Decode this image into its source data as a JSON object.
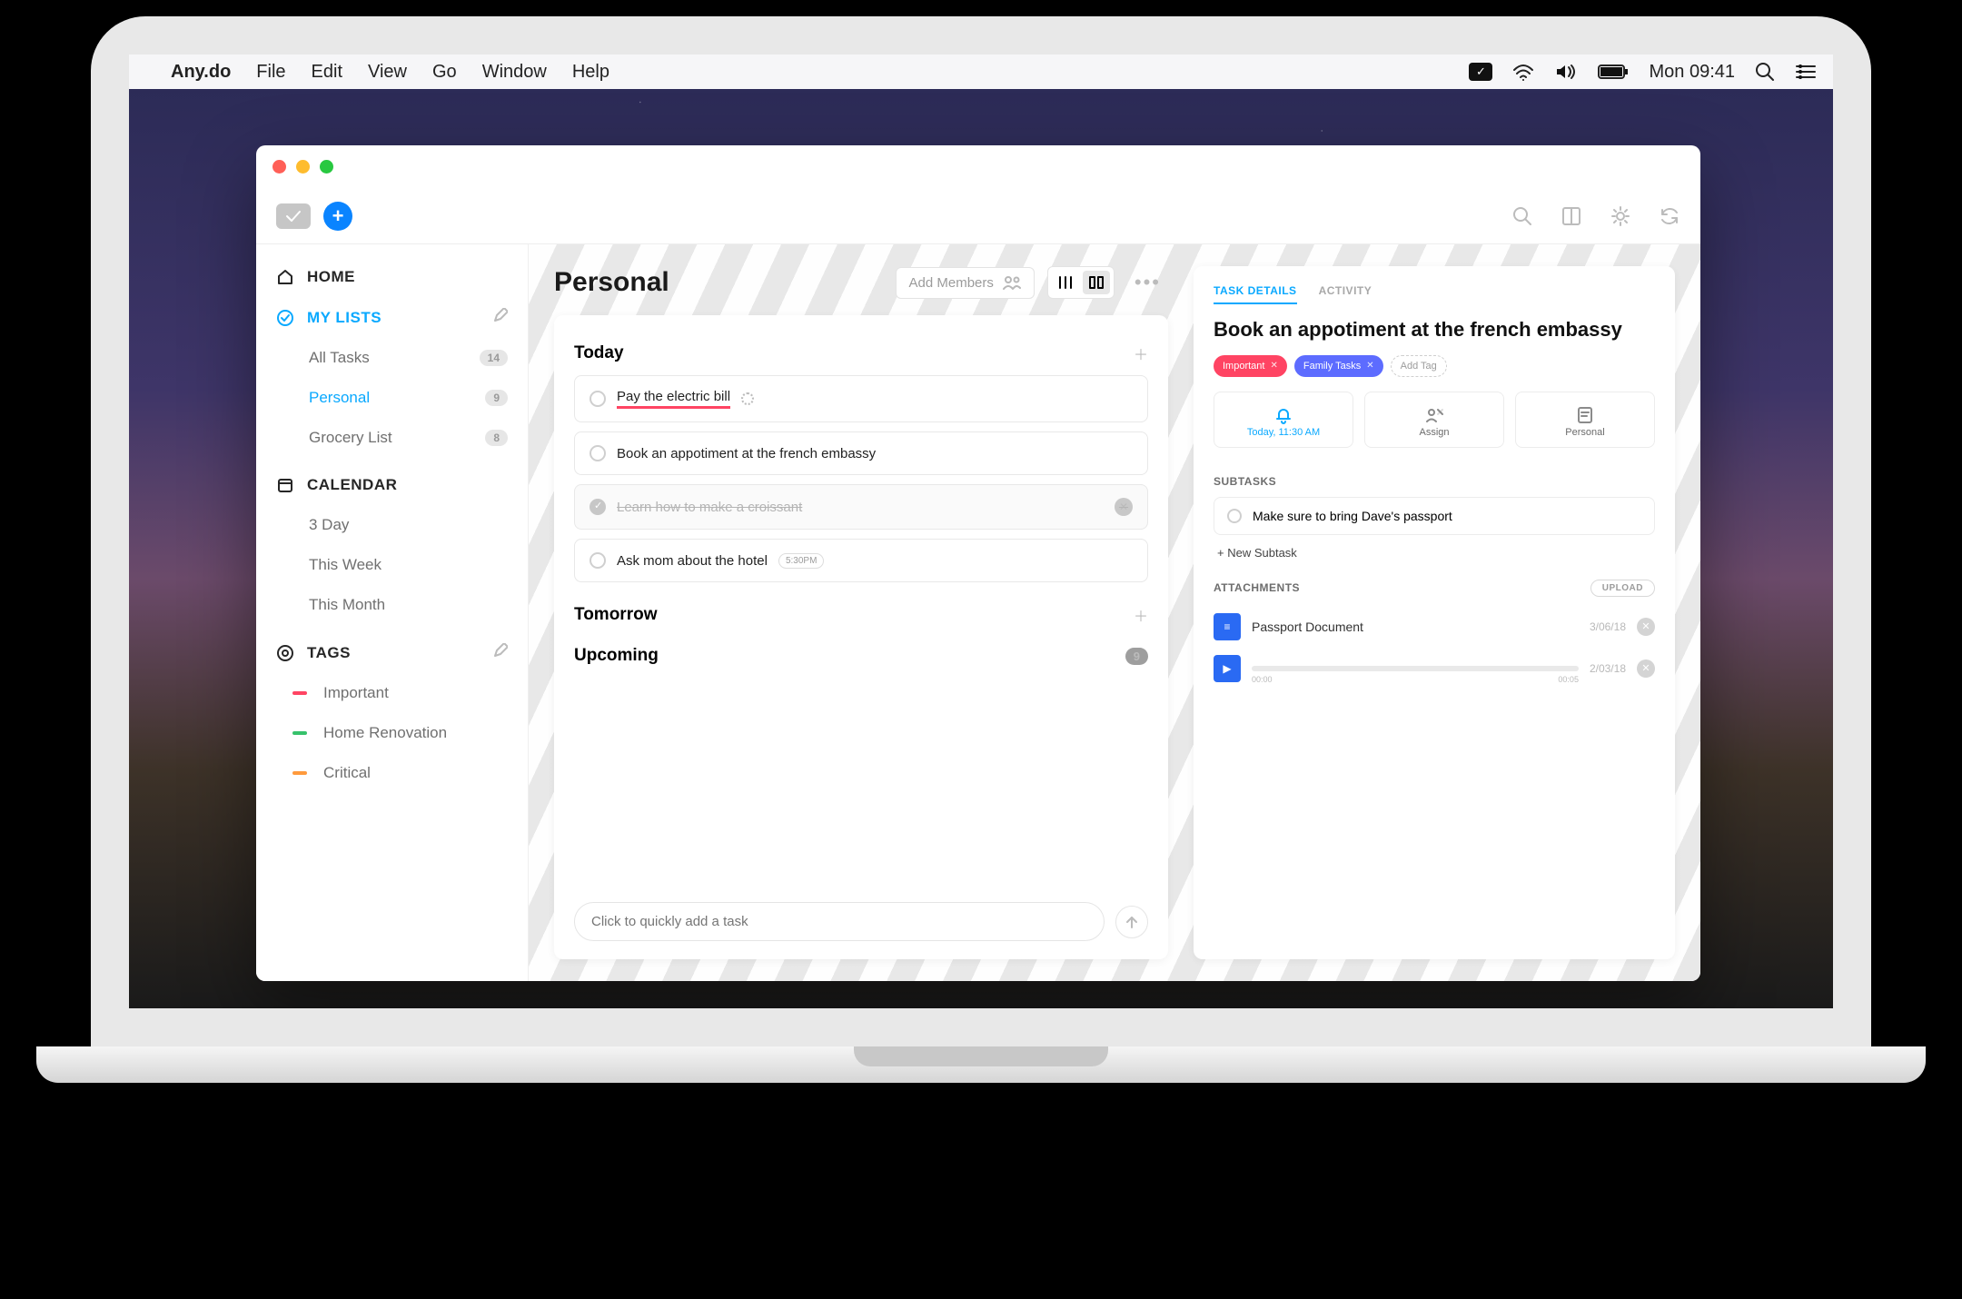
{
  "menubar": {
    "app_name": "Any.do",
    "items": [
      "File",
      "Edit",
      "View",
      "Go",
      "Window",
      "Help"
    ],
    "clock": "Mon 09:41"
  },
  "toolbar": {
    "add_tooltip": "+"
  },
  "sidebar": {
    "home": "HOME",
    "my_lists": "MY LISTS",
    "lists": [
      {
        "label": "All Tasks",
        "count": "14"
      },
      {
        "label": "Personal",
        "count": "9",
        "selected": true
      },
      {
        "label": "Grocery List",
        "count": "8"
      }
    ],
    "calendar": "CALENDAR",
    "calendar_items": [
      "3 Day",
      "This Week",
      "This Month"
    ],
    "tags": "TAGS",
    "tag_items": [
      {
        "label": "Important",
        "color": "#ff4463"
      },
      {
        "label": "Home Renovation",
        "color": "#36c26b"
      },
      {
        "label": "Critical",
        "color": "#ff9a3d"
      }
    ]
  },
  "main": {
    "title": "Personal",
    "add_members": "Add Members",
    "sections": {
      "today": "Today",
      "tomorrow": "Tomorrow",
      "upcoming": "Upcoming",
      "upcoming_count": "9"
    },
    "tasks_today": [
      {
        "label": "Pay the electric bill",
        "underline": true,
        "spinner": true
      },
      {
        "label": "Book an appotiment at the french embassy"
      },
      {
        "label": "Learn how to make a croissant",
        "done": true,
        "removable": true
      },
      {
        "label": "Ask mom about the hotel",
        "time": "5:30PM"
      }
    ],
    "quick_add_placeholder": "Click to quickly add a task"
  },
  "details": {
    "tabs": {
      "details": "TASK DETAILS",
      "activity": "ACTIVITY"
    },
    "title": "Book an appotiment at the french embassy",
    "chips": [
      {
        "label": "Important",
        "kind": "important"
      },
      {
        "label": "Family Tasks",
        "kind": "family"
      },
      {
        "label": "Add Tag",
        "kind": "add"
      }
    ],
    "info": {
      "time": "Today, 11:30 AM",
      "assign": "Assign",
      "list": "Personal"
    },
    "subtasks_title": "SUBTASKS",
    "subtask": "Make sure to bring Dave's passport",
    "new_subtask": "+ New Subtask",
    "attachments_title": "ATTACHMENTS",
    "upload": "UPLOAD",
    "attachments": [
      {
        "label": "Passport Document",
        "date": "3/06/18",
        "type": "doc"
      },
      {
        "label": "",
        "date": "2/03/18",
        "type": "audio",
        "start": "00:00",
        "end": "00:05"
      }
    ]
  }
}
